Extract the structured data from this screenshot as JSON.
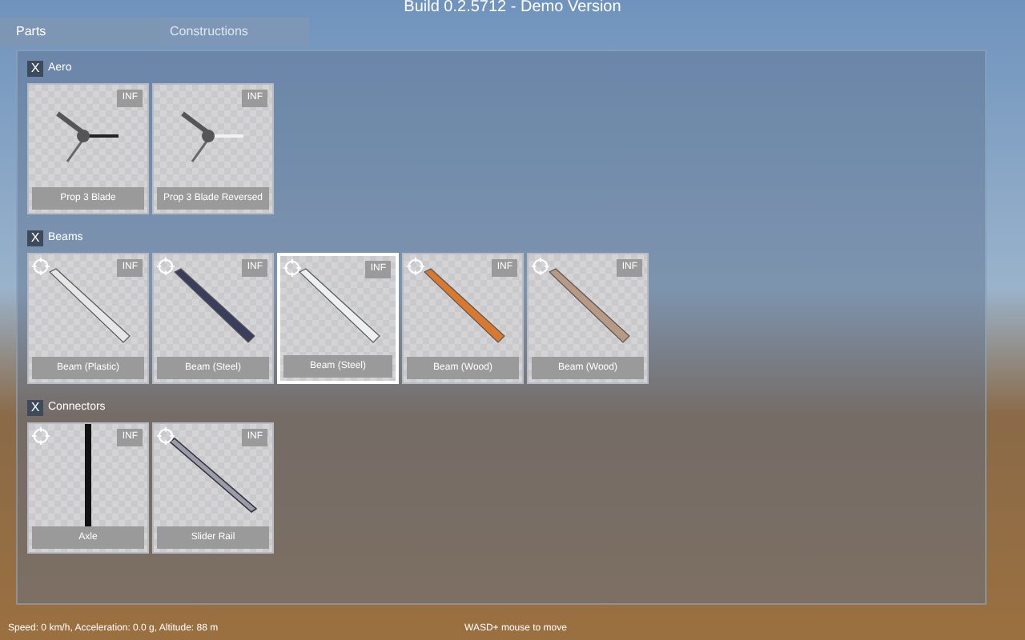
{
  "title": "Build 0.2.5712 - Demo Version",
  "tabs": [
    {
      "label": "Parts",
      "selected": true
    },
    {
      "label": "Constructions",
      "selected": false
    }
  ],
  "sections": [
    {
      "name": "Aero",
      "close": "X",
      "items": [
        {
          "kind": "propeller",
          "label": "Prop 3 Blade",
          "badge": "INF",
          "movable": false,
          "selected": false,
          "color": "#222222"
        },
        {
          "kind": "propeller",
          "label": "Prop 3 Blade Reversed",
          "badge": "INF",
          "movable": false,
          "selected": false,
          "color": "#f2f2f2"
        }
      ]
    },
    {
      "name": "Beams",
      "close": "X",
      "items": [
        {
          "kind": "beam",
          "label": "Beam (Plastic)",
          "badge": "INF",
          "movable": true,
          "selected": false,
          "color": "#e6e6e6"
        },
        {
          "kind": "beam",
          "label": "Beam (Steel)",
          "badge": "INF",
          "movable": true,
          "selected": false,
          "color": "#3a3d5c"
        },
        {
          "kind": "beam",
          "label": "Beam (Steel)",
          "badge": "INF",
          "movable": true,
          "selected": true,
          "color": "#eef0f0"
        },
        {
          "kind": "beam",
          "label": "Beam (Wood)",
          "badge": "INF",
          "movable": true,
          "selected": false,
          "color": "#d9782f"
        },
        {
          "kind": "beam",
          "label": "Beam (Wood)",
          "badge": "INF",
          "movable": true,
          "selected": false,
          "color": "#b89a84"
        }
      ]
    },
    {
      "name": "Connectors",
      "close": "X",
      "items": [
        {
          "kind": "axle",
          "label": "Axle",
          "badge": "INF",
          "movable": true,
          "selected": false,
          "color": "#111111"
        },
        {
          "kind": "rail",
          "label": "Slider Rail",
          "badge": "INF",
          "movable": true,
          "selected": false,
          "color": "#9a9cae"
        }
      ]
    }
  ],
  "status_bar": {
    "stats": "Speed: 0 km/h, Acceleration: 0.0 g, Altitude: 88 m",
    "hint": "WASD+ mouse to move"
  }
}
